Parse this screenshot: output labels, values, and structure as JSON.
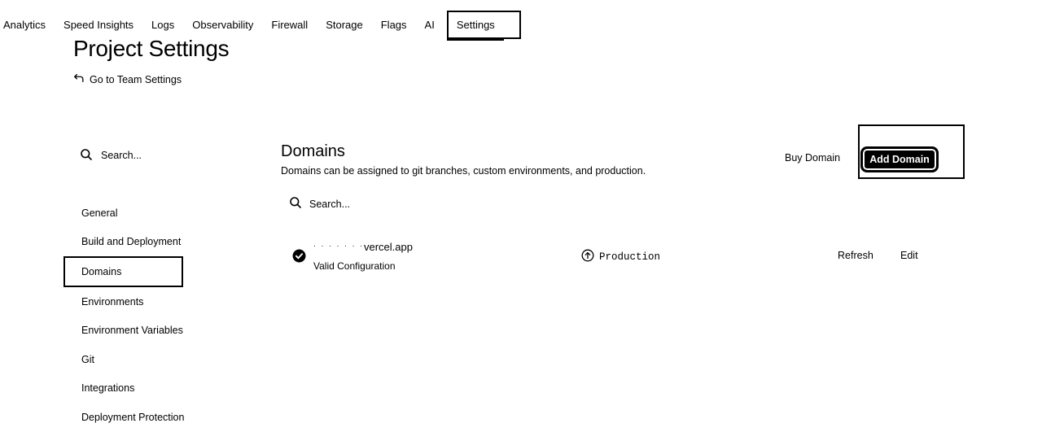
{
  "topnav": {
    "items": [
      {
        "label": "Analytics"
      },
      {
        "label": "Speed Insights"
      },
      {
        "label": "Logs"
      },
      {
        "label": "Observability"
      },
      {
        "label": "Firewall"
      },
      {
        "label": "Storage"
      },
      {
        "label": "Flags"
      },
      {
        "label": "AI"
      },
      {
        "label": "Settings",
        "active": true
      }
    ]
  },
  "header": {
    "title": "Project Settings",
    "back_link": "Go to Team Settings",
    "back_icon": "return-arrow-icon"
  },
  "sidebar": {
    "search_placeholder": "Search...",
    "items": [
      {
        "label": "General"
      },
      {
        "label": "Build and Deployment"
      },
      {
        "label": "Domains",
        "active": true
      },
      {
        "label": "Environments"
      },
      {
        "label": "Environment Variables"
      },
      {
        "label": "Git"
      },
      {
        "label": "Integrations"
      },
      {
        "label": "Deployment Protection"
      }
    ]
  },
  "main": {
    "title": "Domains",
    "subtitle": "Domains can be assigned to git branches, custom environments, and production.",
    "buy_domain": "Buy Domain",
    "add_domain": "Add Domain",
    "search_placeholder": "Search...",
    "domains": [
      {
        "name_masked": "· · · · ·  · ·",
        "name_suffix": "vercel.app",
        "status": "Valid Configuration",
        "status_icon": "check-circle-icon",
        "environment": "Production",
        "environment_icon": "arrow-up-circle-icon",
        "refresh": "Refresh",
        "edit": "Edit"
      }
    ]
  },
  "colors": {
    "text": "#000000",
    "background": "#ffffff",
    "primary_button_bg": "#000000",
    "primary_button_text": "#ffffff"
  }
}
